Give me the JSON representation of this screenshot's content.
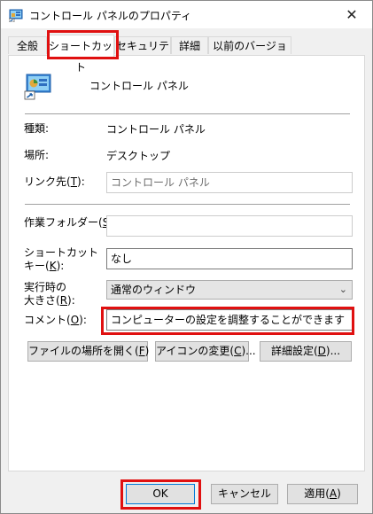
{
  "window": {
    "title": "コントロール パネルのプロパティ",
    "close_glyph": "✕"
  },
  "tabs": [
    {
      "label": "全般"
    },
    {
      "label": "ショートカット"
    },
    {
      "label": "セキュリティ"
    },
    {
      "label": "詳細"
    },
    {
      "label": "以前のバージョン"
    }
  ],
  "header": {
    "name": "コントロール パネル"
  },
  "rows": {
    "type_label": "種類:",
    "type_value": "コントロール パネル",
    "location_label": "場所:",
    "location_value": "デスクトップ",
    "target_label_pre": "リンク先(",
    "target_label_key": "T",
    "target_label_post": "):",
    "target_value": "コントロール パネル",
    "startin_label_pre": "作業フォルダー(",
    "startin_label_key": "S",
    "startin_label_post": "):",
    "startin_value": "",
    "shortcut_label_line1": "ショートカット",
    "shortcut_label_pre": "キー(",
    "shortcut_label_key": "K",
    "shortcut_label_post": "):",
    "shortcut_value": "なし",
    "run_label_line1": "実行時の",
    "run_label_pre": "大きさ(",
    "run_label_key": "R",
    "run_label_post": "):",
    "run_value": "通常のウィンドウ",
    "comment_label_pre": "コメント(",
    "comment_label_key": "O",
    "comment_label_post": "):",
    "comment_value": "コンピューターの設定を調整することができます"
  },
  "action_buttons": {
    "open_location_pre": "ファイルの場所を開く(",
    "open_location_key": "F",
    "open_location_post": ")",
    "change_icon_pre": "アイコンの変更(",
    "change_icon_key": "C",
    "change_icon_post": ")...",
    "advanced_pre": "詳細設定(",
    "advanced_key": "D",
    "advanced_post": ")..."
  },
  "footer": {
    "ok": "OK",
    "cancel": "キャンセル",
    "apply_pre": "適用(",
    "apply_key": "A",
    "apply_post": ")"
  },
  "colors": {
    "highlight": "#e01010",
    "default_button_border": "#0078d7"
  },
  "icons": {
    "window_icon": "control-panel-icon",
    "big_icon": "control-panel-icon"
  }
}
